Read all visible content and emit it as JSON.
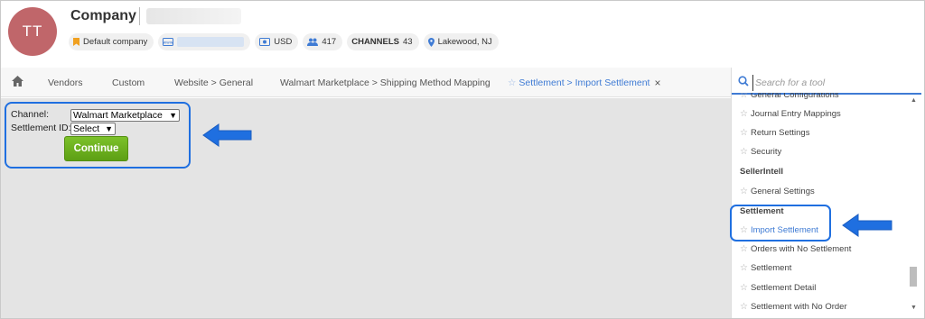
{
  "company": {
    "avatar_initials": "TT",
    "name": "Company",
    "chips": {
      "default_company": "Default company",
      "currency": "USD",
      "users": "417",
      "channels_label": "CHANNELS",
      "channels_count": "43",
      "location": "Lakewood, NJ"
    }
  },
  "nav": {
    "tabs": [
      "Vendors",
      "Custom",
      "Website > General",
      "Walmart Marketplace > Shipping Method Mapping",
      "Settlement > Import Settlement"
    ]
  },
  "form": {
    "channel_label": "Channel:",
    "channel_value": "Walmart Marketplace",
    "settlement_label": "Settlement ID:",
    "settlement_value": "Select",
    "continue_label": "Continue"
  },
  "tools": {
    "search_placeholder": "Search for a tool",
    "cut_item": "General Configurations",
    "items_top": [
      "Journal Entry Mappings",
      "Return Settings",
      "Security"
    ],
    "group_sellerintell": "SellerIntell",
    "sellerintell_items": [
      "General Settings"
    ],
    "group_settlement": "Settlement",
    "settlement_items": [
      "Import Settlement",
      "Orders with No Settlement",
      "Settlement",
      "Settlement Detail",
      "Settlement with No Order"
    ]
  },
  "colors": {
    "accent": "#3f7bd4",
    "highlight": "#1f6fe0",
    "continue_button": "#6bb11f",
    "avatar": "#c0666a"
  }
}
